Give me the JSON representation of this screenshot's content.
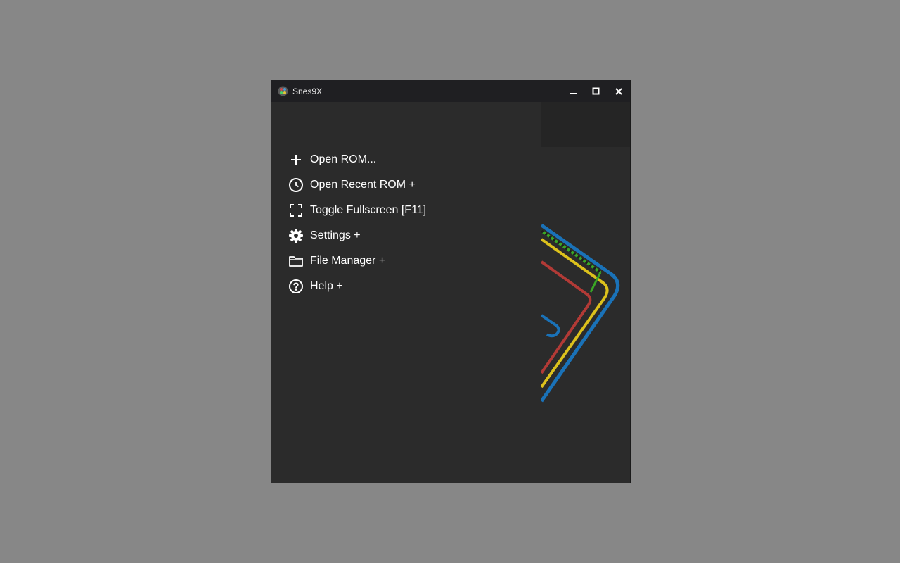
{
  "window": {
    "title": "Snes9X",
    "app_icon": "snes9x-logo-icon",
    "controls": [
      {
        "name": "minimize-button",
        "icon": "minimize-icon"
      },
      {
        "name": "maximize-button",
        "icon": "maximize-icon"
      },
      {
        "name": "close-button",
        "icon": "close-icon"
      }
    ]
  },
  "menu": {
    "items": [
      {
        "label": "Open ROM...",
        "icon": "plus-icon"
      },
      {
        "label": "Open Recent ROM +",
        "icon": "clock-icon"
      },
      {
        "label": "Toggle Fullscreen [F11]",
        "icon": "fullscreen-icon"
      },
      {
        "label": "Settings +",
        "icon": "gear-icon"
      },
      {
        "label": "File Manager +",
        "icon": "folder-icon"
      },
      {
        "label": "Help +",
        "icon": "help-icon"
      }
    ]
  },
  "colors": {
    "background": "#878787",
    "panel": "#2b2b2b",
    "titlebar": "#1f1f22",
    "art_blue": "#1a72b8",
    "art_yellow": "#dcc11c",
    "art_red": "#b23a36",
    "art_green": "#3aa626"
  }
}
